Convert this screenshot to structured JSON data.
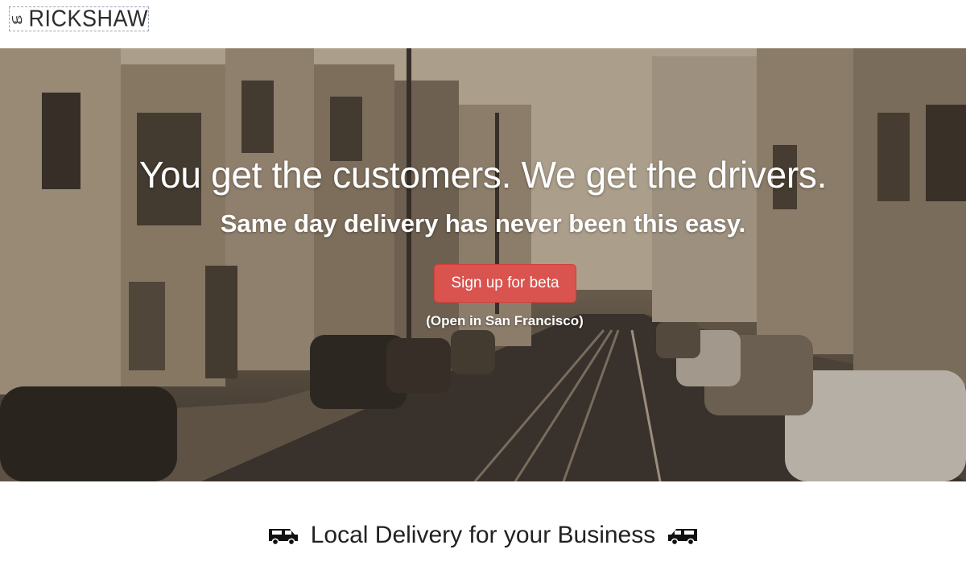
{
  "header": {
    "logo_text": "RICKSHAW",
    "logo_mark_icon": "rickshaw-logo-icon"
  },
  "hero": {
    "headline": "You get the customers. We get the drivers.",
    "subheadline": "Same day delivery has never been this easy.",
    "cta_label": "Sign up for beta",
    "cta_note": "(Open in San Francisco)"
  },
  "section": {
    "title": "Local Delivery for your Business",
    "left_icon": "delivery-van-icon",
    "right_icon": "delivery-van-icon"
  },
  "colors": {
    "cta_background": "#d9534f",
    "hero_tint": "#8a7a64",
    "text_dark": "#222222"
  }
}
